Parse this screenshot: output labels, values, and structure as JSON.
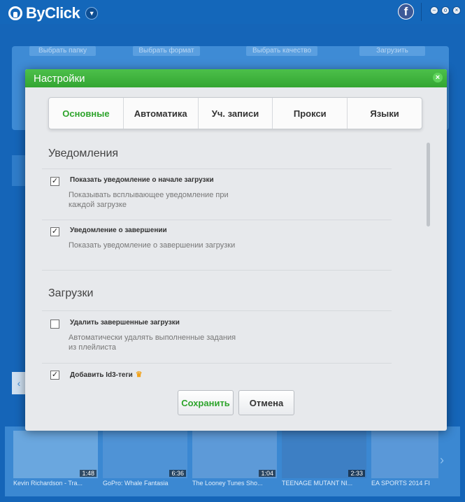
{
  "app": {
    "brand": "ByClick",
    "menu_icon": "chevron-down-icon",
    "facebook_icon": "facebook-icon",
    "window_controls": [
      "minimize",
      "restore",
      "close"
    ]
  },
  "background": {
    "buttons": [
      "Выбрать папку",
      "Выбрать формат",
      "Выбрать качество",
      "Загрузить"
    ],
    "thumbnails": [
      {
        "title": "Kevin Richardson - Tra...",
        "duration": "1:48"
      },
      {
        "title": "GoPro: Whale Fantasia",
        "duration": "6:36"
      },
      {
        "title": "The Looney Tunes Sho...",
        "duration": "1:04"
      },
      {
        "title": "TEENAGE MUTANT NI...",
        "duration": "2:33"
      },
      {
        "title": "EA SPORTS 2014 FI",
        "duration": ""
      }
    ]
  },
  "dialog": {
    "title": "Настройки",
    "tabs": [
      "Основные",
      "Автоматика",
      "Уч. записи",
      "Прокси",
      "Языки"
    ],
    "active_tab": "Основные",
    "sections": [
      {
        "title": "Уведомления",
        "options": [
          {
            "label": "Показать уведомление о начале загрузки",
            "description": "Показывать всплывающее уведомление при каждой загрузке",
            "checked": true
          },
          {
            "label": "Уведомление о завершении",
            "description": "Показать уведомление о завершении загрузки",
            "checked": true
          }
        ]
      },
      {
        "title": "Загрузки",
        "options": [
          {
            "label": "Удалить завершенные загрузки",
            "description": "Автоматически удалять выполненные задания из плейлиста",
            "checked": false
          },
          {
            "label": "Добавить Id3-теги",
            "description": "",
            "checked": true,
            "premium_icon": "crown-icon"
          }
        ]
      }
    ],
    "buttons": {
      "save": "Сохранить",
      "cancel": "Отмена"
    },
    "colors": {
      "accent": "#2ea42c",
      "header": "#3db23b"
    }
  }
}
